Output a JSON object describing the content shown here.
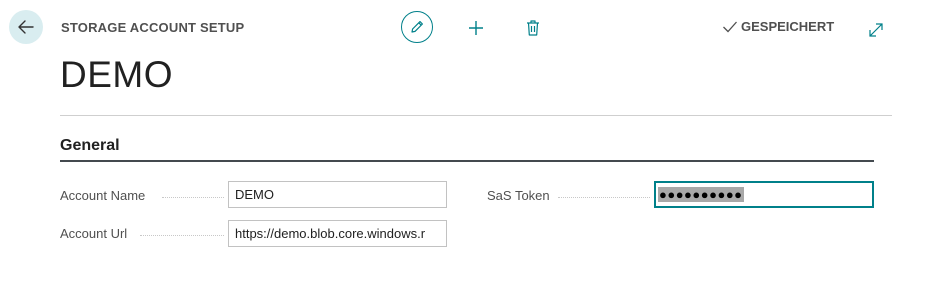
{
  "header": {
    "caption": "STORAGE ACCOUNT SETUP",
    "status": "GESPEICHERT",
    "icons": [
      "back-arrow-icon",
      "pencil-icon",
      "plus-icon",
      "trash-icon",
      "checkmark-icon",
      "expand-icon"
    ]
  },
  "page": {
    "title": "DEMO"
  },
  "section": {
    "title": "General"
  },
  "fields": {
    "account_name": {
      "label": "Account Name",
      "value": "DEMO"
    },
    "account_url": {
      "label": "Account Url",
      "value": "https://demo.blob.core.windows.r"
    },
    "sas_token": {
      "label": "SaS Token",
      "value": "●●●●●●●●●●"
    }
  },
  "colors": {
    "accent": "#00808a",
    "back_button_bg": "#d9edf0",
    "section_line": "#444a4f"
  }
}
